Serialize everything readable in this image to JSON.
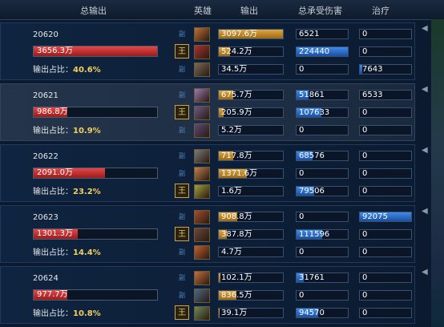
{
  "header": {
    "total_output": "总输出",
    "hero": "英雄",
    "output": "输出",
    "damage_taken": "总承受伤害",
    "heal": "治疗"
  },
  "side_tag": "570",
  "colors": {
    "total_bar": "#c8302f",
    "output_bar": "#d39a32",
    "damage_bar": "#2f7ad6"
  },
  "players": [
    {
      "id": "20620",
      "total": "3656.3万",
      "total_fraction": 1.0,
      "share_label": "输出占比：",
      "share": "40.6%",
      "rows": [
        {
          "tag": "副",
          "output": "3097.6万",
          "output_fraction": 1.0,
          "damage": "6521",
          "damage_fraction": 0.0,
          "heal": "0",
          "heal_fraction": 0.0
        },
        {
          "tag": "王",
          "output": "524.2万",
          "output_fraction": 0.17,
          "damage": "224440",
          "damage_fraction": 1.0,
          "heal": "0",
          "heal_fraction": 0.0
        },
        {
          "tag": "副",
          "output": "34.5万",
          "output_fraction": 0.0,
          "damage": "0",
          "damage_fraction": 0.0,
          "heal": "7643",
          "heal_fraction": 0.04
        }
      ]
    },
    {
      "id": "20621",
      "total": "986.8万",
      "total_fraction": 0.27,
      "share_label": "输出占比：",
      "share": "10.9%",
      "rows": [
        {
          "tag": "副",
          "output": "675.7万",
          "output_fraction": 0.22,
          "damage": "51861",
          "damage_fraction": 0.23,
          "heal": "6533",
          "heal_fraction": 0.0
        },
        {
          "tag": "王",
          "output": "205.9万",
          "output_fraction": 0.07,
          "damage": "107633",
          "damage_fraction": 0.48,
          "heal": "0",
          "heal_fraction": 0.0
        },
        {
          "tag": "副",
          "output": "5.2万",
          "output_fraction": 0.0,
          "damage": "0",
          "damage_fraction": 0.0,
          "heal": "0",
          "heal_fraction": 0.0
        }
      ]
    },
    {
      "id": "20622",
      "total": "2091.0万",
      "total_fraction": 0.58,
      "share_label": "输出占比：",
      "share": "23.2%",
      "rows": [
        {
          "tag": "副",
          "output": "717.8万",
          "output_fraction": 0.23,
          "damage": "68576",
          "damage_fraction": 0.31,
          "heal": "0",
          "heal_fraction": 0.0
        },
        {
          "tag": "副",
          "output": "1371.6万",
          "output_fraction": 0.44,
          "damage": "0",
          "damage_fraction": 0.0,
          "heal": "0",
          "heal_fraction": 0.0
        },
        {
          "tag": "王",
          "output": "1.6万",
          "output_fraction": 0.0,
          "damage": "79506",
          "damage_fraction": 0.35,
          "heal": "0",
          "heal_fraction": 0.0
        }
      ]
    },
    {
      "id": "20623",
      "total": "1301.3万",
      "total_fraction": 0.36,
      "share_label": "输出占比：",
      "share": "14.4%",
      "rows": [
        {
          "tag": "副",
          "output": "908.8万",
          "output_fraction": 0.29,
          "damage": "0",
          "damage_fraction": 0.0,
          "heal": "92075",
          "heal_fraction": 1.0
        },
        {
          "tag": "王",
          "output": "387.8万",
          "output_fraction": 0.13,
          "damage": "111596",
          "damage_fraction": 0.5,
          "heal": "0",
          "heal_fraction": 0.0
        },
        {
          "tag": "副",
          "output": "4.7万",
          "output_fraction": 0.0,
          "damage": "0",
          "damage_fraction": 0.0,
          "heal": "0",
          "heal_fraction": 0.0
        }
      ]
    },
    {
      "id": "20624",
      "total": "977.7万",
      "total_fraction": 0.27,
      "share_label": "输出占比：",
      "share": "10.8%",
      "rows": [
        {
          "tag": "副",
          "output": "102.1万",
          "output_fraction": 0.03,
          "damage": "31761",
          "damage_fraction": 0.14,
          "heal": "0",
          "heal_fraction": 0.0
        },
        {
          "tag": "副",
          "output": "836.5万",
          "output_fraction": 0.27,
          "damage": "0",
          "damage_fraction": 0.0,
          "heal": "0",
          "heal_fraction": 0.0
        },
        {
          "tag": "王",
          "output": "39.1万",
          "output_fraction": 0.01,
          "damage": "94570",
          "damage_fraction": 0.42,
          "heal": "0",
          "heal_fraction": 0.0
        }
      ]
    }
  ]
}
